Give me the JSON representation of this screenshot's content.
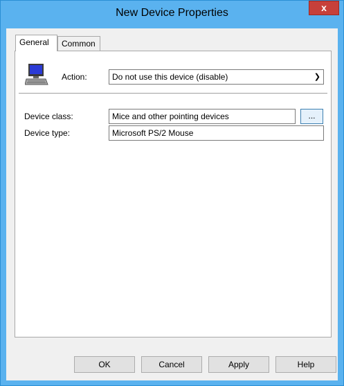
{
  "window": {
    "title": "New Device Properties",
    "close_glyph": "x"
  },
  "tabs": [
    {
      "label": "General",
      "active": true
    },
    {
      "label": "Common",
      "active": false
    }
  ],
  "general": {
    "icon": "computer-icon",
    "action_label": "Action:",
    "action_value": "Do not use this device (disable)",
    "device_class_label": "Device class:",
    "device_class_value": "Mice and other pointing devices",
    "browse_label": "...",
    "device_type_label": "Device type:",
    "device_type_value": "Microsoft PS/2 Mouse"
  },
  "buttons": {
    "ok": "OK",
    "cancel": "Cancel",
    "apply": "Apply",
    "help": "Help"
  }
}
